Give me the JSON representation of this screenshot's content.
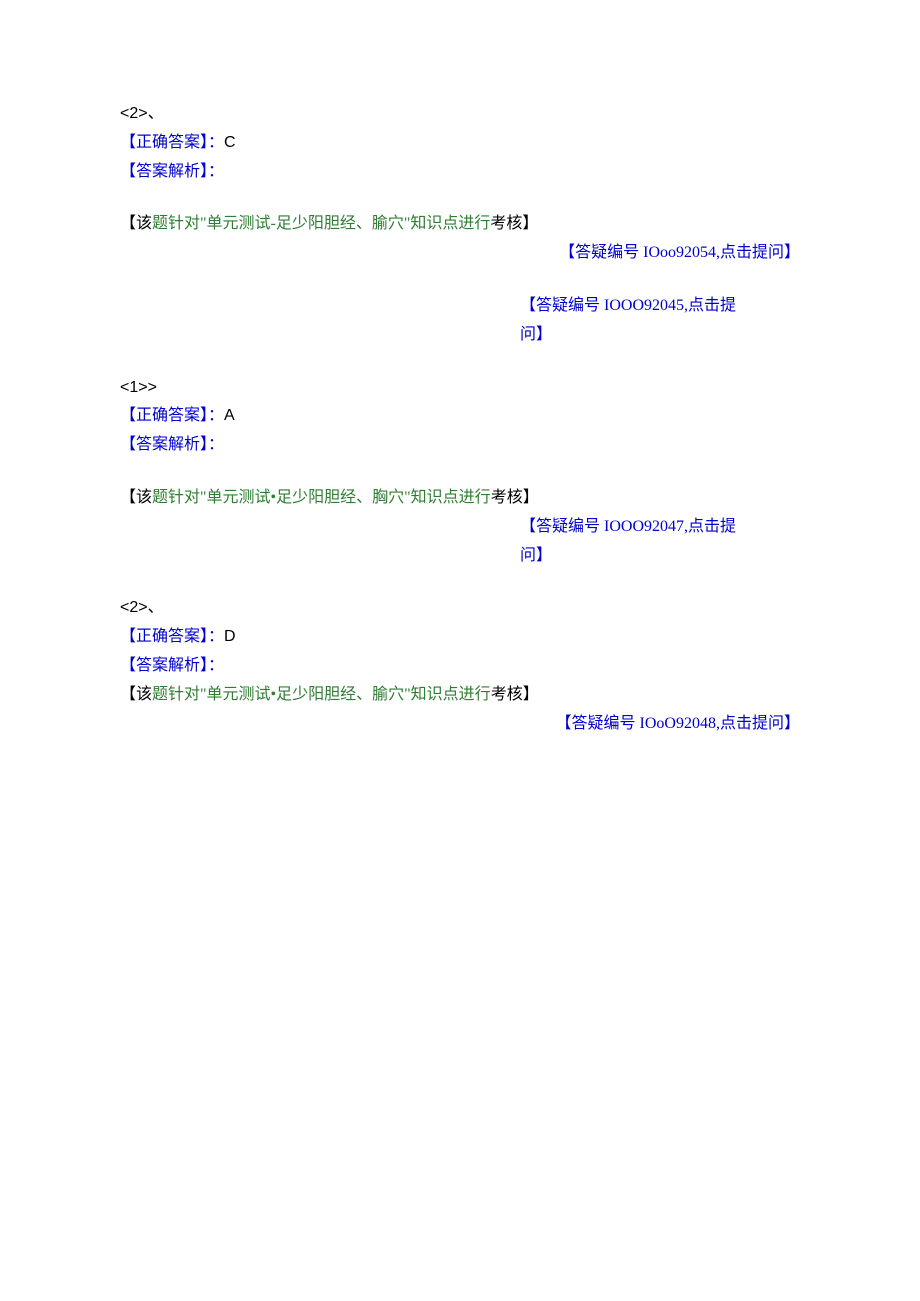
{
  "block1": {
    "num": "<2>、",
    "ans_label": "【正确答案】：",
    "ans_val": "C",
    "analysis_label": "【答案解析】：",
    "note_open": "【该",
    "note_green": "题针对\"单元测试-足少阳胆经、腧穴\"知识点进行",
    "note_close": "考核】",
    "qid1": "【答疑编号 IOoo92054,点击提问】",
    "qid2_a": "【答疑编号 IOOO92045,点击提",
    "qid2_b": "问】"
  },
  "block2": {
    "num": "<1>>",
    "ans_label": "【正确答案】：",
    "ans_val": "A",
    "analysis_label": "【答案解析】：",
    "note_open": "【该",
    "note_green": "题针对\"单元测试•足少阳胆经、胸穴\"知识点进行",
    "note_close": "考核】",
    "qid_a": "【答疑编号 IOOO92047,点击提",
    "qid_b": "问】"
  },
  "block3": {
    "num": "<2>、",
    "ans_label": "【正确答案】：",
    "ans_val": "D",
    "analysis_label": "【答案解析】：",
    "note_open": "【该",
    "note_green": "题针对\"单元测试•足少阳胆经、腧穴\"知识点进行",
    "note_close": "考核】",
    "qid": "【答疑编号 IOoO92048,点击提问】"
  }
}
